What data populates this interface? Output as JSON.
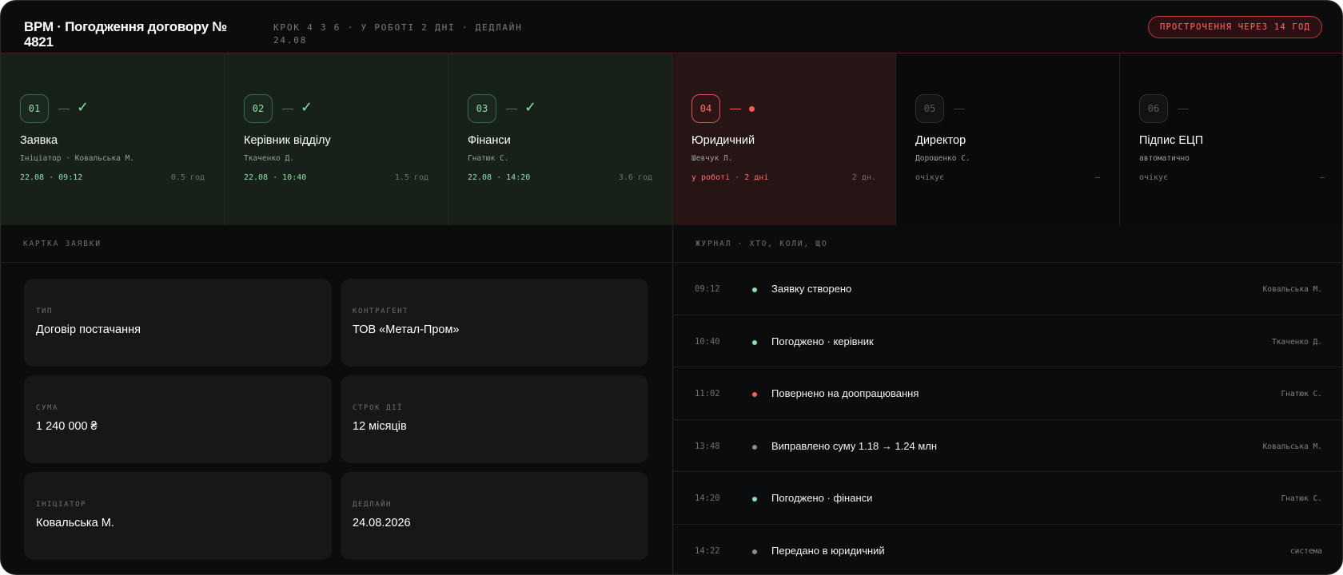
{
  "header": {
    "title": "BPM · Погодження договору № 4821",
    "meta": "КРОК 4 З 6 · У РОБОТІ 2 ДНІ · ДЕДЛАЙН 24.08",
    "overdue_label": "ПРОСТРОЧЕННЯ ЧЕРЕЗ 14 ГОД"
  },
  "colors": {
    "done": "#8ee0a8",
    "active": "#ff5f5a",
    "pending": "#56595c",
    "background": "#0b0c0d"
  },
  "steps": [
    {
      "num": "01",
      "status": "done",
      "name": "Заявка",
      "person": "Ініціатор · Ковальська М.",
      "time": "22.08 · 09:12",
      "duration": "0.5 год"
    },
    {
      "num": "02",
      "status": "done",
      "name": "Керівник відділу",
      "person": "Ткаченко Д.",
      "time": "22.08 · 10:40",
      "duration": "1.5 год"
    },
    {
      "num": "03",
      "status": "done",
      "name": "Фінанси",
      "person": "Гнатюк С.",
      "time": "22.08 · 14:20",
      "duration": "3.6 год"
    },
    {
      "num": "04",
      "status": "active",
      "name": "Юридичний",
      "person": "Шевчук Л.",
      "time": "у роботі · 2 дні",
      "duration": "2 дн."
    },
    {
      "num": "05",
      "status": "pending",
      "name": "Директор",
      "person": "Дорошенко С.",
      "time": "очікує",
      "duration": "—"
    },
    {
      "num": "06",
      "status": "pending",
      "name": "Підпис ЕЦП",
      "person": "автоматично",
      "time": "очікує",
      "duration": "—"
    }
  ],
  "card_panel": {
    "title": "КАРТКА ЗАЯВКИ",
    "fields": [
      {
        "label": "ТИП",
        "value": "Договір постачання"
      },
      {
        "label": "КОНТРАГЕНТ",
        "value": "ТОВ «Метал-Пром»"
      },
      {
        "label": "СУМА",
        "value": "1 240 000 ₴"
      },
      {
        "label": "СТРОК ДІЇ",
        "value": "12 місяців"
      },
      {
        "label": "ІНІЦІАТОР",
        "value": "Ковальська М."
      },
      {
        "label": "ДЕДЛАЙН",
        "value": "24.08.2026"
      }
    ]
  },
  "log_panel": {
    "title": "ЖУРНАЛ · ХТО, КОЛИ, ЩО",
    "entries": [
      {
        "time": "09:12",
        "status": "green",
        "text": "Заявку створено",
        "who": "Ковальська М."
      },
      {
        "time": "10:40",
        "status": "green",
        "text": "Погоджено · керівник",
        "who": "Ткаченко Д."
      },
      {
        "time": "11:02",
        "status": "red",
        "text": "Повернено на доопрацювання",
        "who": "Гнатюк С."
      },
      {
        "time": "13:48",
        "status": "gray",
        "text": "Виправлено суму 1.18 → 1.24 млн",
        "who": "Ковальська М."
      },
      {
        "time": "14:20",
        "status": "green",
        "text": "Погоджено · фінанси",
        "who": "Гнатюк С."
      },
      {
        "time": "14:22",
        "status": "gray",
        "text": "Передано в юридичний",
        "who": "система"
      }
    ]
  },
  "log_dot_colors": {
    "green": "#8ee0a8",
    "red": "#ff5f5a",
    "gray": "#8a8d90"
  }
}
